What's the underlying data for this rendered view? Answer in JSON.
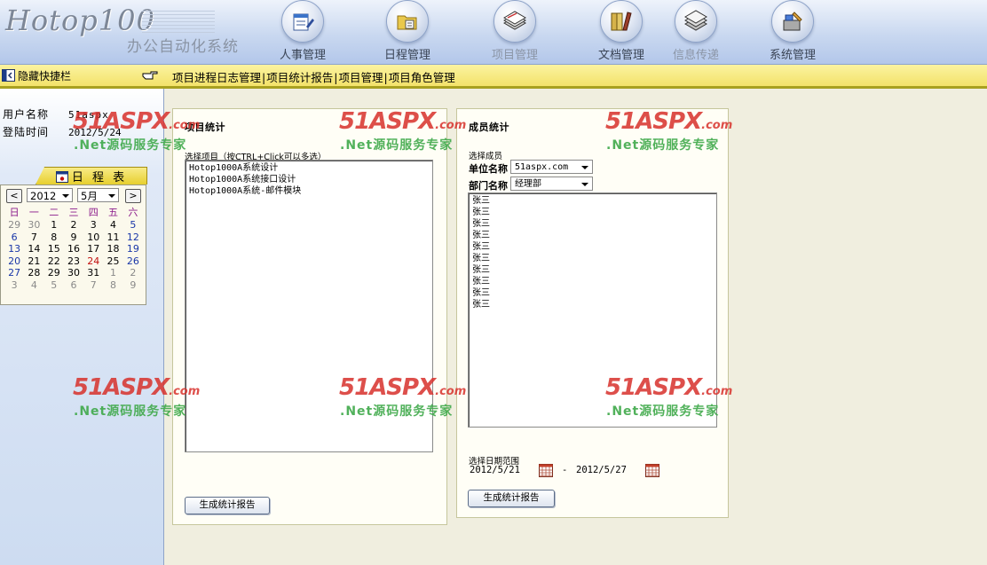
{
  "header": {
    "logo_text": "Hotop100",
    "subtitle": "办公自动化系统",
    "nav": [
      {
        "label": "人事管理",
        "icon": "personnel-icon"
      },
      {
        "label": "日程管理",
        "icon": "schedule-folder-icon"
      },
      {
        "label": "项目管理",
        "icon": "project-stack-icon"
      },
      {
        "label": "文档管理",
        "icon": "documents-icon"
      },
      {
        "label": "信息传递",
        "icon": "messages-icon"
      },
      {
        "label": "系统管理",
        "icon": "system-tools-icon"
      }
    ]
  },
  "toolbar": {
    "hide_shortcut": "隐藏快捷栏",
    "links": [
      "项目进程日志管理",
      "项目统计报告",
      "项目管理",
      "项目角色管理"
    ]
  },
  "sidebar": {
    "user_label": "用户名称",
    "user_value": "51aspx",
    "login_label": "登陆时间",
    "login_value": "2012/5/24",
    "calendar": {
      "title": "日 程 表",
      "prev": "<",
      "next": ">",
      "year": "2012",
      "month": "5月",
      "weekdays": [
        "日",
        "一",
        "二",
        "三",
        "四",
        "五",
        "六"
      ],
      "weeks": [
        [
          "29",
          "30",
          "1",
          "2",
          "3",
          "4",
          "5"
        ],
        [
          "6",
          "7",
          "8",
          "9",
          "10",
          "11",
          "12"
        ],
        [
          "13",
          "14",
          "15",
          "16",
          "17",
          "18",
          "19"
        ],
        [
          "20",
          "21",
          "22",
          "23",
          "24",
          "25",
          "26"
        ],
        [
          "27",
          "28",
          "29",
          "30",
          "31",
          "1",
          "2"
        ],
        [
          "3",
          "4",
          "5",
          "6",
          "7",
          "8",
          "9"
        ]
      ],
      "today": "24"
    }
  },
  "project_panel": {
    "title": "项目统计",
    "select_label": "选择项目（按CTRL+Click可以多选）",
    "projects": [
      "Hotop1000A系统设计",
      "Hotop1000A系统接口设计",
      "Hotop1000A系统-邮件模块"
    ],
    "button": "生成统计报告"
  },
  "member_panel": {
    "title": "成员统计",
    "select_member_label": "选择成员",
    "unit_label": "单位名称",
    "unit_value": "51aspx.com",
    "dept_label": "部门名称",
    "dept_value": "经理部",
    "members": [
      "张三",
      "张三",
      "张三",
      "张三",
      "张三",
      "张三",
      "张三",
      "张三",
      "张三",
      "张三"
    ],
    "date_range_label": "选择日期范围",
    "start_date": "2012/5/21",
    "date_sep": "-",
    "end_date": "2012/5/27",
    "button": "生成统计报告"
  },
  "watermark": {
    "brand_num": "51",
    "brand_text": "ASPX",
    "domain": ".com",
    "tagline": ".Net源码服务专家"
  }
}
